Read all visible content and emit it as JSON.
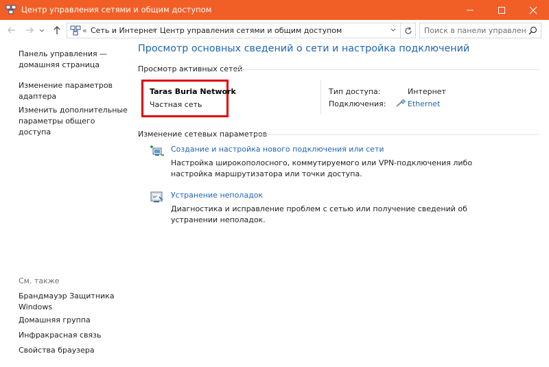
{
  "window": {
    "title": "Центр управления сетями и общим доступом",
    "accent_color": "#f25f26"
  },
  "nav": {
    "breadcrumb": [
      "Сеть и Интернет",
      "Центр управления сетями и общим доступом"
    ],
    "breadcrumb_separator": "›",
    "root_separator": "«",
    "search_placeholder": "Поиск в панели управления"
  },
  "sidebar": {
    "links": [
      {
        "label": "Панель управления — домашняя страница"
      },
      {
        "label": "Изменение параметров адаптера"
      },
      {
        "label": "Изменить дополнительные параметры общего доступа"
      }
    ],
    "see_also_label": "См. также",
    "see_also": [
      {
        "label": "Брандмауэр Защитника Windows"
      },
      {
        "label": "Домашняя группа"
      },
      {
        "label": "Инфракрасная связь"
      },
      {
        "label": "Свойства браузера"
      }
    ]
  },
  "main": {
    "title": "Просмотр основных сведений о сети и настройка подключений",
    "active_networks_header": "Просмотр активных сетей",
    "network": {
      "name": "Taras Buria Network",
      "type": "Частная сеть",
      "access_type_label": "Тип доступа:",
      "access_type_value": "Интернет",
      "connections_label": "Подключения:",
      "connection_value": "Ethernet"
    },
    "change_settings_header": "Изменение сетевых параметров",
    "tasks": [
      {
        "link": "Создание и настройка нового подключения или сети",
        "description": "Настройка широкополосного, коммутируемого или VPN-подключения либо настройка маршрутизатора или точки доступа.",
        "icon": "new-connection-icon"
      },
      {
        "link": "Устранение неполадок",
        "description": "Диагностика и исправление проблем с сетью или получение сведений об устранении неполадок.",
        "icon": "troubleshoot-icon"
      }
    ],
    "highlight_color": "#e00000",
    "link_color": "#1e64b4"
  }
}
